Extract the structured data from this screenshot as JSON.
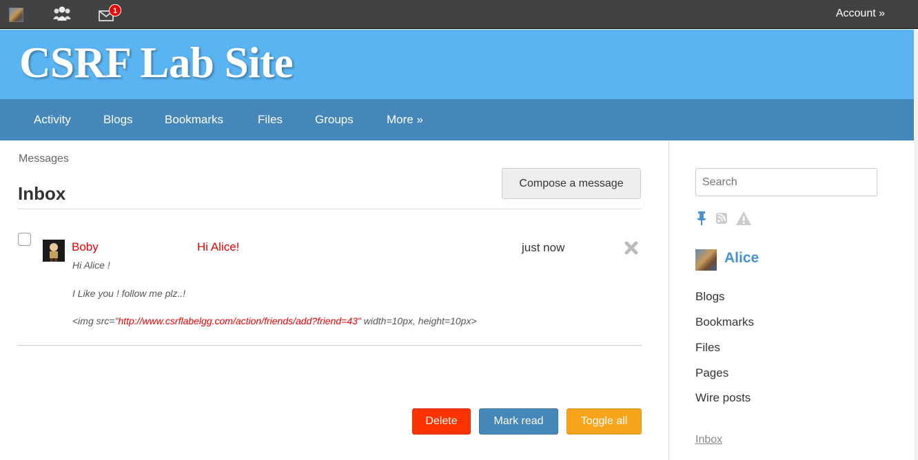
{
  "topbar": {
    "notification_count": "1",
    "account_label": "Account »"
  },
  "header": {
    "site_title": "CSRF Lab Site"
  },
  "nav": {
    "items": [
      "Activity",
      "Blogs",
      "Bookmarks",
      "Files",
      "Groups",
      "More »"
    ]
  },
  "main": {
    "breadcrumb": "Messages",
    "title": "Inbox",
    "compose_label": "Compose a message",
    "message": {
      "from": "Boby",
      "subject": "Hi Alice!",
      "time": "just now",
      "body_line1": "Hi Alice !",
      "body_line2": "I Like you ! follow me plz..!",
      "body_line3_prefix": "<img src=\"",
      "body_line3_link": "http://www.csrflabelgg.com/action/friends/add?friend=43\"",
      "body_line3_suffix": " width=10px, height=10px>"
    },
    "actions": {
      "delete": "Delete",
      "mark_read": "Mark read",
      "toggle_all": "Toggle all"
    }
  },
  "sidebar": {
    "search_placeholder": "Search",
    "owner_name": "Alice",
    "owner_links": [
      "Blogs",
      "Bookmarks",
      "Files",
      "Pages",
      "Wire posts"
    ],
    "inbox_link": "Inbox"
  },
  "colors": {
    "topbar": "#424242",
    "header": "#5ab4f2",
    "nav": "#4487b8",
    "link_red": "#ee0000",
    "delete_button": "#ff3300",
    "mark_read_button": "#4487b8",
    "toggle_button": "#f8a51c"
  },
  "icons": [
    "avatar",
    "friends-icon",
    "mail-icon",
    "delete-x-icon",
    "pin-icon",
    "rss-icon",
    "warning-icon"
  ]
}
